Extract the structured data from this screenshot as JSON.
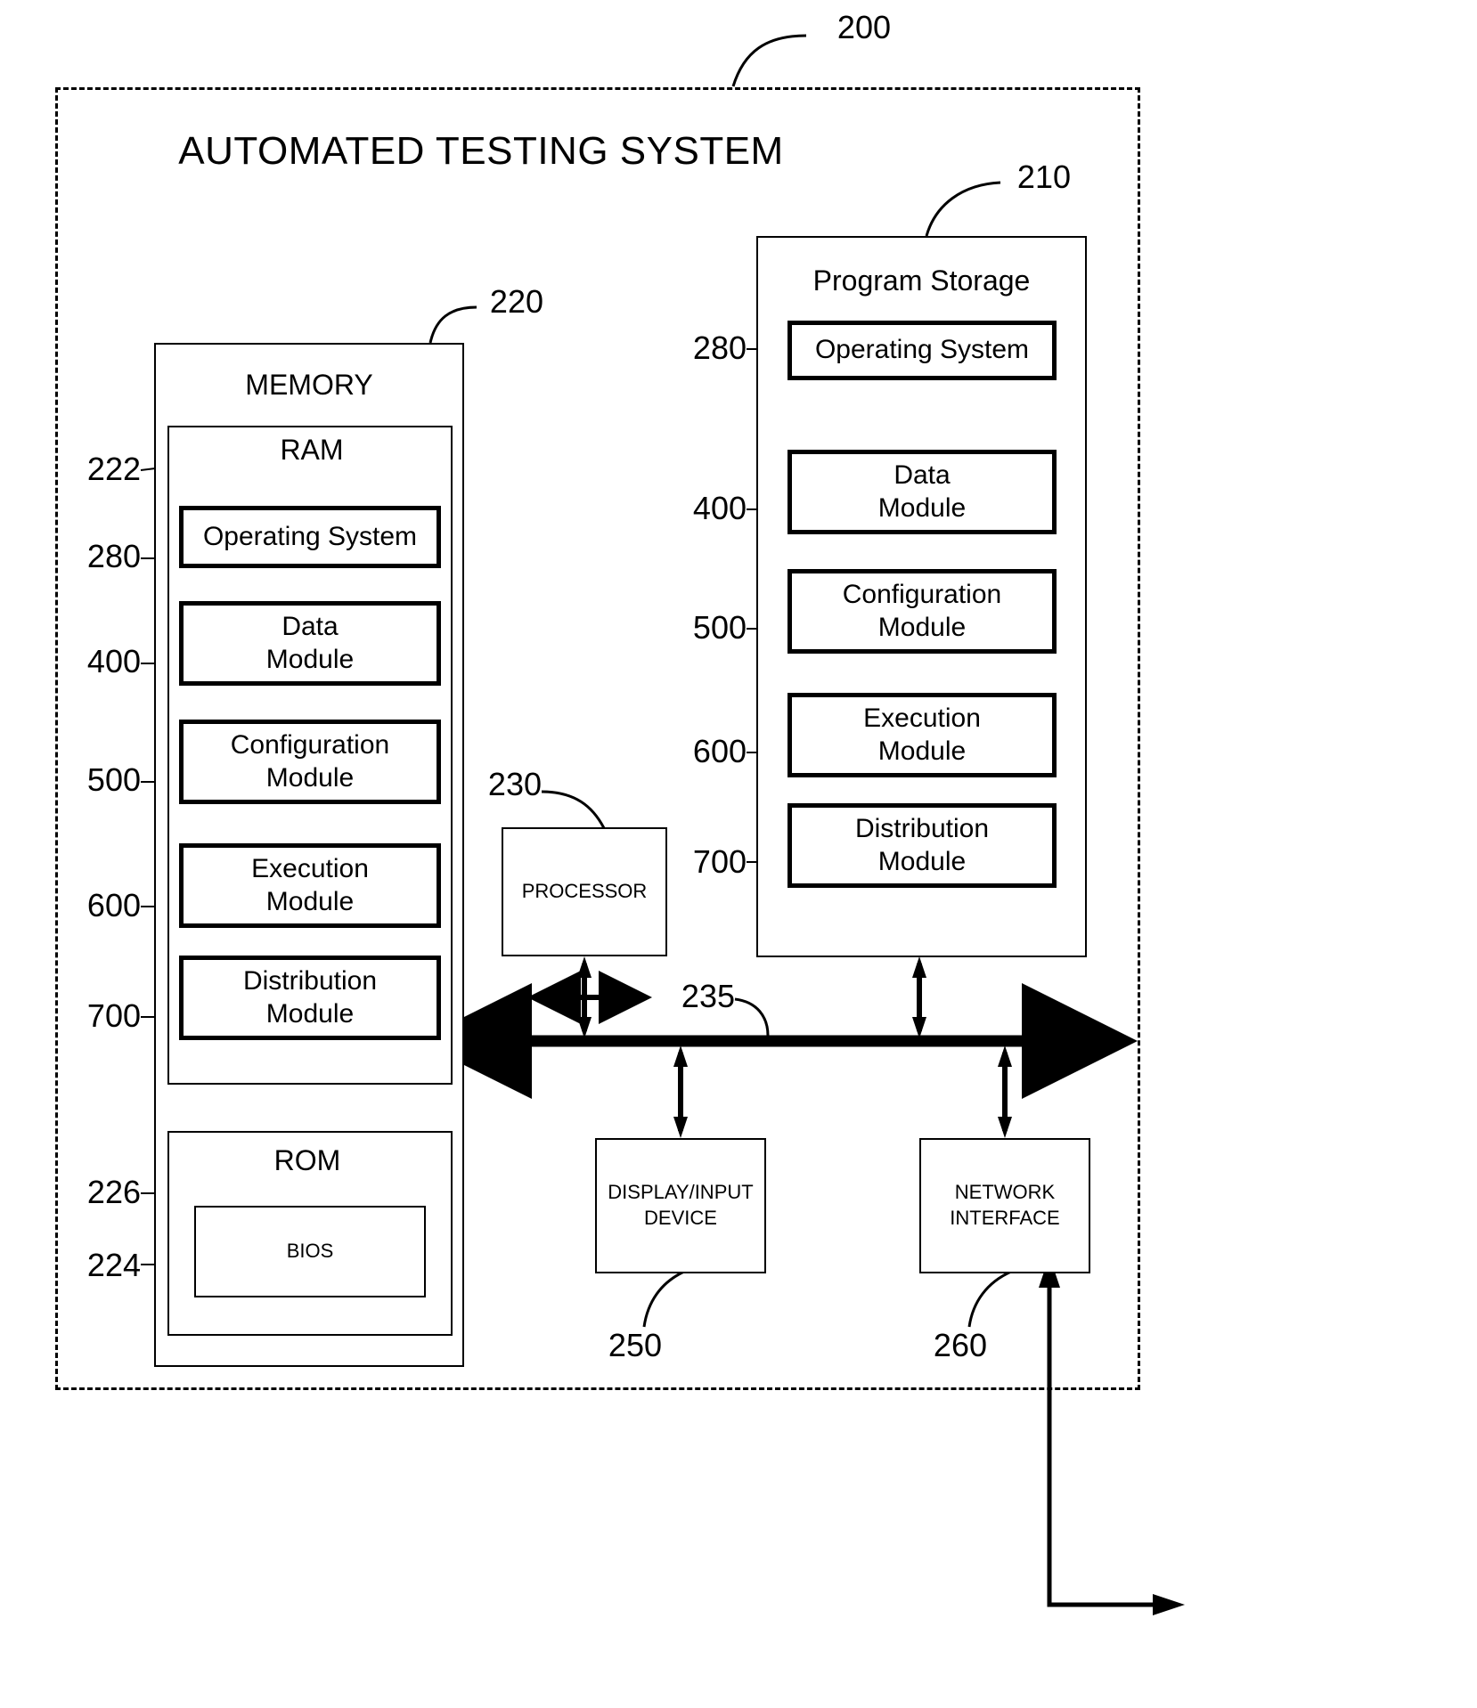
{
  "figure": {
    "system_label": "200",
    "title": "AUTOMATED TESTING SYSTEM"
  },
  "memory": {
    "ref": "220",
    "title": "MEMORY",
    "ram": {
      "ref": "222",
      "title": "RAM",
      "modules": [
        {
          "ref": "280",
          "label": "Operating System"
        },
        {
          "ref": "400",
          "label": "Data\nModule",
          "line1": "Data",
          "line2": "Module"
        },
        {
          "ref": "500",
          "label": "Configuration\nModule",
          "line1": "Configuration",
          "line2": "Module"
        },
        {
          "ref": "600",
          "label": "Execution\nModule",
          "line1": "Execution",
          "line2": "Module"
        },
        {
          "ref": "700",
          "label": "Distribution\nModule",
          "line1": "Distribution",
          "line2": "Module"
        }
      ]
    },
    "rom": {
      "ref": "226",
      "title": "ROM",
      "bios": {
        "ref": "224",
        "label": "BIOS"
      }
    }
  },
  "program_storage": {
    "ref": "210",
    "title": "Program Storage",
    "modules": [
      {
        "ref": "280",
        "line1": "Operating System",
        "line2": ""
      },
      {
        "ref": "400",
        "line1": "Data",
        "line2": "Module"
      },
      {
        "ref": "500",
        "line1": "Configuration",
        "line2": "Module"
      },
      {
        "ref": "600",
        "line1": "Execution",
        "line2": "Module"
      },
      {
        "ref": "700",
        "line1": "Distribution",
        "line2": "Module"
      }
    ]
  },
  "processor": {
    "ref": "230",
    "label": "PROCESSOR"
  },
  "bus": {
    "ref": "235"
  },
  "display_input_device": {
    "ref": "250",
    "line1": "DISPLAY/INPUT",
    "line2": "DEVICE"
  },
  "network_interface": {
    "ref": "260",
    "line1": "NETWORK",
    "line2": "INTERFACE"
  }
}
